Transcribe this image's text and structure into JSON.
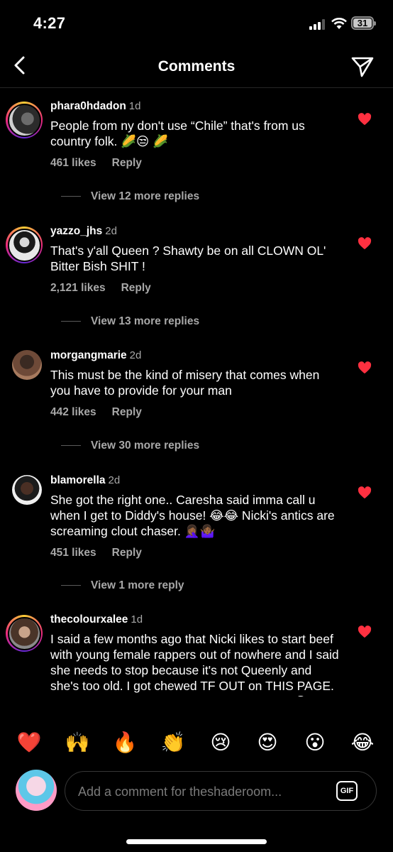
{
  "status_bar": {
    "time": "4:27",
    "battery": "31"
  },
  "header": {
    "title": "Comments",
    "back_icon": "chevron-left-icon",
    "send_icon": "paper-plane-icon"
  },
  "comments": [
    {
      "username": "phara0hdadon",
      "age": "1d",
      "text": "People from ny don't use “Chile” that's from us country folk. 🌽😒 🌽",
      "likes": "461 likes",
      "reply_label": "Reply",
      "view_replies": "View 12 more replies",
      "liked": true
    },
    {
      "username": "yazzo_jhs",
      "age": "2d",
      "text": "That's y'all Queen ? Shawty be on all CLOWN OL' Bitter Bish SHIT !",
      "likes": "2,121 likes",
      "reply_label": "Reply",
      "view_replies": "View 13 more replies",
      "liked": true
    },
    {
      "username": "morgangmarie",
      "age": "2d",
      "text": "This must be the kind of misery that comes when you have to provide for your man",
      "likes": "442 likes",
      "reply_label": "Reply",
      "view_replies": "View 30 more replies",
      "liked": true
    },
    {
      "username": "blamorella",
      "age": "2d",
      "text": "She got the right one.. Caresha said imma call u when I get to Diddy's house! 😂😂 Nicki's antics are screaming clout chaser. 🤦🏾‍♀️🤷🏾‍♀️",
      "likes": "451 likes",
      "reply_label": "Reply",
      "view_replies": "View 1 more reply",
      "liked": true
    },
    {
      "username": "thecolourxalee",
      "age": "1d",
      "text": "I said a few months ago that Nicki likes to start beef with young female rappers out of nowhere and I said she needs to stop because it's not Queenly and she's too old.  I got chewed TF OUT on THIS PAGE. Now you all here like \"wuss wrong with Nicki😒\"",
      "liked": true
    }
  ],
  "reactions": [
    "❤️",
    "🙌",
    "🔥",
    "👏",
    "😢",
    "😍",
    "😮",
    "😂"
  ],
  "composer": {
    "placeholder": "Add a comment for theshaderoom...",
    "gif_label": "GIF"
  },
  "colors": {
    "background": "#000000",
    "heart": "#ff3040",
    "secondary_text": "#a8a8a8"
  }
}
